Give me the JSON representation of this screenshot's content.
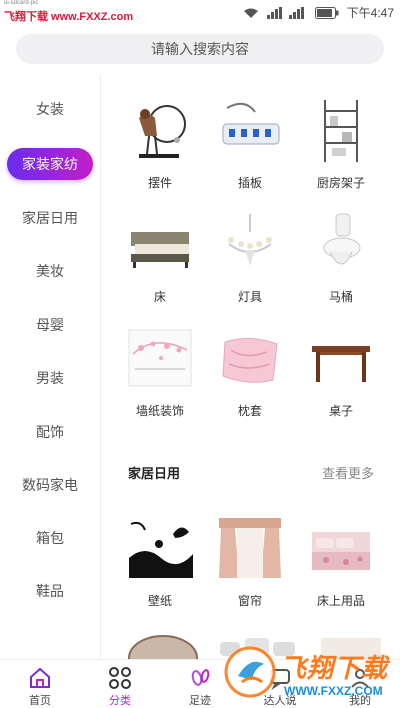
{
  "status_bar": {
    "watermark": "飞翔下载 www.FXXZ.com",
    "time": "下午4:47",
    "battery_icon": "battery-icon",
    "wifi_icon": "wifi-icon",
    "signal_icon": "signal-icon"
  },
  "search": {
    "placeholder": "请输入搜索内容"
  },
  "categories": [
    {
      "label": "女装"
    },
    {
      "label": "家装家纺",
      "active": true
    },
    {
      "label": "家居日用"
    },
    {
      "label": "美妆"
    },
    {
      "label": "母婴"
    },
    {
      "label": "男装"
    },
    {
      "label": "配饰"
    },
    {
      "label": "数码家电"
    },
    {
      "label": "箱包"
    },
    {
      "label": "鞋品"
    }
  ],
  "grid": [
    {
      "label": "摆件",
      "icon": "ornament-image"
    },
    {
      "label": "插板",
      "icon": "power-strip-image"
    },
    {
      "label": "厨房架子",
      "icon": "kitchen-shelf-image"
    },
    {
      "label": "床",
      "icon": "bed-image"
    },
    {
      "label": "灯具",
      "icon": "chandelier-image"
    },
    {
      "label": "马桶",
      "icon": "toilet-image"
    },
    {
      "label": "墙纸装饰",
      "icon": "wallpaper-decal-image"
    },
    {
      "label": "枕套",
      "icon": "pillowcase-image"
    },
    {
      "label": "桌子",
      "icon": "table-image"
    }
  ],
  "section": {
    "title": "家居日用",
    "more": "查看更多"
  },
  "grid2": [
    {
      "label": "壁纸",
      "icon": "wallpaper-image"
    },
    {
      "label": "窗帘",
      "icon": "curtain-image"
    },
    {
      "label": "床上用品",
      "icon": "bedding-image"
    }
  ],
  "nav": [
    {
      "label": "首页",
      "icon": "home-icon"
    },
    {
      "label": "分类",
      "icon": "category-icon",
      "active": true
    },
    {
      "label": "足迹",
      "icon": "footprint-icon"
    },
    {
      "label": "达人说",
      "icon": "talk-icon"
    },
    {
      "label": "我的",
      "icon": "profile-icon"
    }
  ],
  "watermark_br": {
    "text": "飞翔下载",
    "url": "WWW.FXXZ.COM"
  },
  "colors": {
    "accent_start": "#6a2cf0",
    "accent_end": "#c21fc7",
    "watermark_red": "#e0183b",
    "watermark_orange": "#ff7a1a"
  }
}
